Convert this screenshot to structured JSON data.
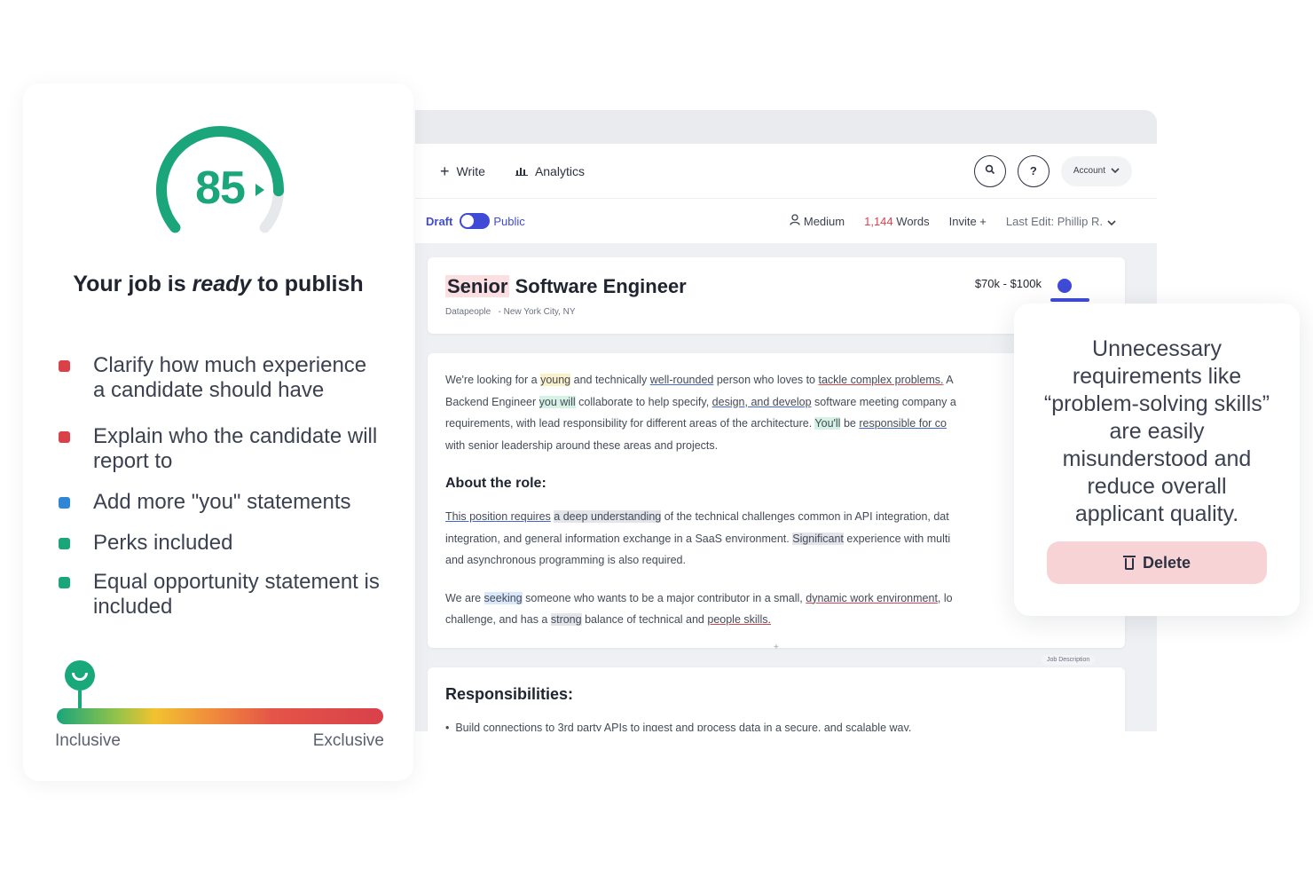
{
  "score_panel": {
    "score": "85",
    "score_fraction": 0.85,
    "title_prefix": "Your job is ",
    "title_emphasis": "ready",
    "title_suffix": " to publish",
    "checklist": [
      {
        "text": "Clarify how much experience a candidate should have",
        "color": "#d9404a"
      },
      {
        "text": "Explain who the candidate will report to",
        "color": "#d9404a"
      },
      {
        "text": "Add more \"you\" statements",
        "color": "#2f86d6"
      },
      {
        "text": "Perks included",
        "color": "#1aa57a"
      },
      {
        "text": "Equal opportunity statement is included",
        "color": "#1aa57a"
      }
    ],
    "scale": {
      "left_label": "Inclusive",
      "right_label": "Exclusive",
      "position": 0.07
    }
  },
  "toolbar": {
    "write_label": "Write",
    "analytics_label": "Analytics",
    "account_label": "Account",
    "help_glyph": "?"
  },
  "status": {
    "draft_label": "Draft",
    "public_label": "Public",
    "reading_level": "Medium",
    "words_count": "1,144",
    "words_label": "Words",
    "invite_label": "Invite +",
    "last_edit": "Last Edit: Phillip R."
  },
  "job": {
    "title_highlight": "Senior",
    "title_rest": " Software Engineer",
    "company": "Datapeople",
    "location": "- New York City, NY",
    "salary": "$70k - $100k"
  },
  "body": {
    "p1": [
      [
        "We're looking for a ",
        ""
      ],
      [
        "young",
        "hl-yellow"
      ],
      [
        " and technically ",
        ""
      ],
      [
        "well-rounded",
        "ul-blue"
      ],
      [
        " person who loves to ",
        ""
      ],
      [
        "tackle complex problems.",
        "ul-red"
      ],
      [
        " A",
        ""
      ]
    ],
    "p1_line2": [
      [
        "Backend Engineer ",
        ""
      ],
      [
        "you will",
        "hl-green"
      ],
      [
        " collaborate to help specify, ",
        ""
      ],
      [
        "design, and develop",
        "ul-blue"
      ],
      [
        " software meeting company a",
        ""
      ]
    ],
    "p1_line3": [
      [
        "requirements, with lead responsibility for different areas of the architecture. ",
        ""
      ],
      [
        "You'll",
        "hl-green"
      ],
      [
        " be ",
        ""
      ],
      [
        "responsible for co",
        "ul-blue"
      ]
    ],
    "p1_line4": [
      [
        "with senior leadership around these areas and projects.",
        ""
      ]
    ],
    "about_heading": "About the role:",
    "p2_line1": [
      [
        "This position requires",
        "ul-blue"
      ],
      [
        " ",
        ""
      ],
      [
        "a deep understanding",
        "hl-grey"
      ],
      [
        " of the technical challenges common in API integration, dat",
        ""
      ]
    ],
    "p2_line2": [
      [
        "integration, and general information exchange in a SaaS environment. ",
        ""
      ],
      [
        "Significant",
        "hl-grey"
      ],
      [
        " experience with multi",
        ""
      ]
    ],
    "p2_line3": [
      [
        "and asynchronous programming is also required.",
        ""
      ]
    ],
    "p3_line1": [
      [
        "We are ",
        ""
      ],
      [
        "seeking",
        "hl-blue"
      ],
      [
        " someone who wants to be a major contributor in a small, ",
        ""
      ],
      [
        "dynamic work environment,",
        "ul-red"
      ],
      [
        " lo",
        ""
      ]
    ],
    "p3_line2": [
      [
        "challenge, and has a ",
        ""
      ],
      [
        "strong",
        "hl-grey"
      ],
      [
        " balance of technical and ",
        ""
      ],
      [
        "people skills.",
        "ul-red"
      ]
    ],
    "jd_tag": "Job Description"
  },
  "responsibilities": {
    "heading": "Responsibilities:",
    "first_item": "Build connections to 3rd party APIs to ingest and process data in a secure, and scalable way."
  },
  "tooltip": {
    "message": "Unnecessary requirements like “problem-solving skills” are easily misunderstood and reduce overall applicant quality.",
    "delete_label": "Delete"
  },
  "colors": {
    "brand_blue": "#3f4bd6",
    "score_green": "#1aa57a",
    "delete_bg": "#f7d3d6"
  }
}
